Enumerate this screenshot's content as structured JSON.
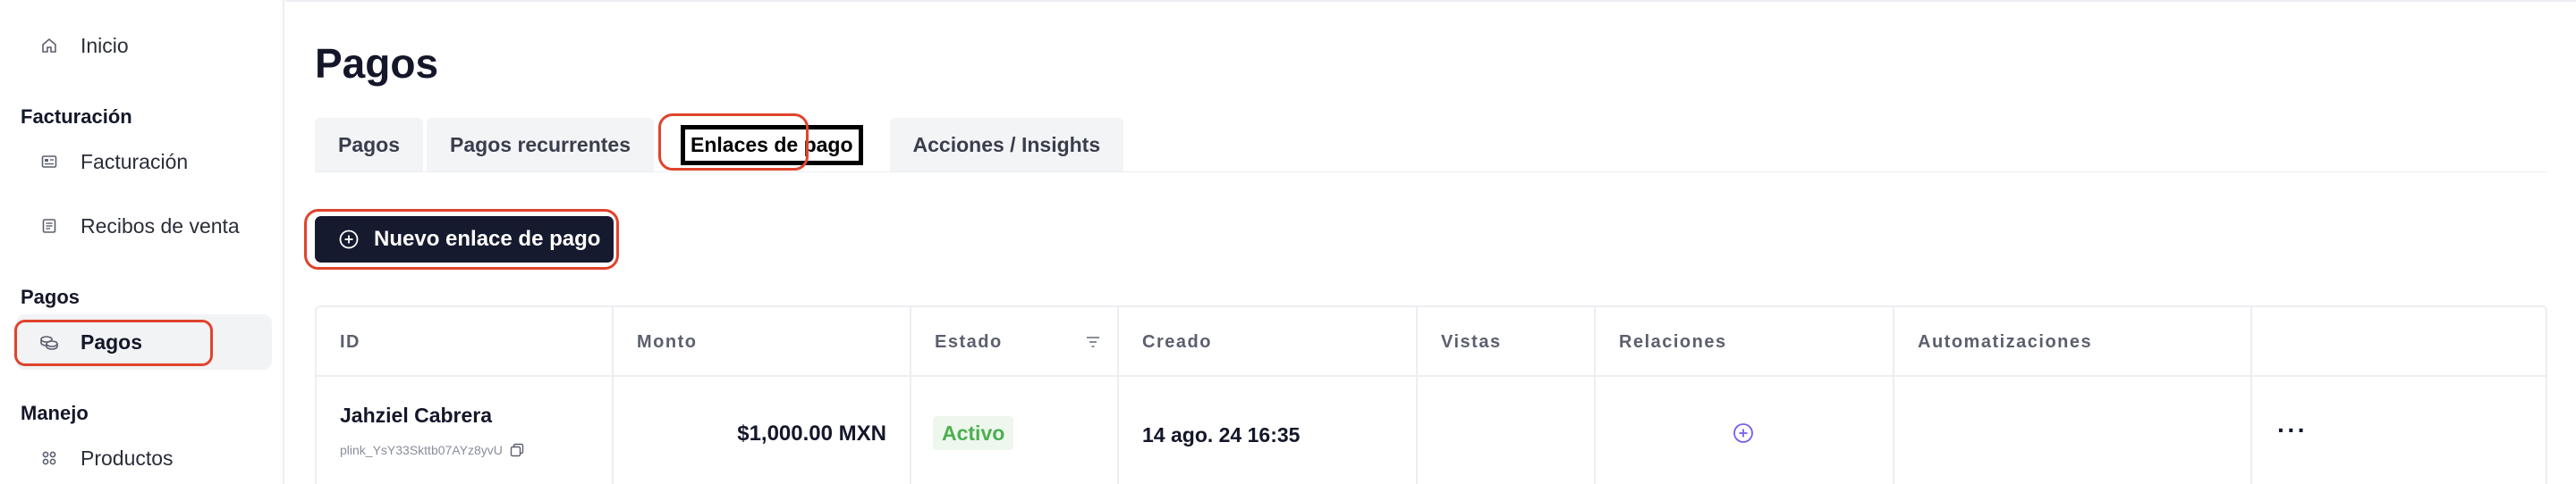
{
  "sidebar": {
    "home": {
      "label": "Inicio",
      "icon": "home-icon"
    },
    "sections": [
      {
        "title": "Facturación",
        "items": [
          {
            "label": "Facturación",
            "icon": "invoice-icon"
          },
          {
            "label": "Recibos de venta",
            "icon": "receipt-icon"
          }
        ]
      },
      {
        "title": "Pagos",
        "items": [
          {
            "label": "Pagos",
            "icon": "coins-icon",
            "active": true
          }
        ]
      },
      {
        "title": "Manejo",
        "items": [
          {
            "label": "Productos",
            "icon": "grid-icon"
          }
        ]
      }
    ]
  },
  "page": {
    "title": "Pagos"
  },
  "tabs": [
    {
      "label": "Pagos"
    },
    {
      "label": "Pagos recurrentes"
    },
    {
      "label": "Enlaces de pago",
      "active": true
    },
    {
      "label": "Acciones / Insights"
    }
  ],
  "new_button": {
    "label": "Nuevo enlace de pago",
    "icon": "plus-circle-icon"
  },
  "table": {
    "columns": [
      "ID",
      "Monto",
      "Estado",
      "Creado",
      "Vistas",
      "Relaciones",
      "Automatizaciones",
      ""
    ],
    "rows": [
      {
        "name": "Jahziel Cabrera",
        "link_id": "plink_YsY33Skttb07AYz8yvU",
        "amount": "$1,000.00 MXN",
        "status": "Activo",
        "created": "14 ago. 24 16:35",
        "views": "",
        "automations": "",
        "more": "···"
      }
    ]
  },
  "colors": {
    "accent_dark": "#161a2e",
    "highlight": "#e0432c",
    "status_active": "#4caf50",
    "relation_icon": "#7b5cf0"
  }
}
